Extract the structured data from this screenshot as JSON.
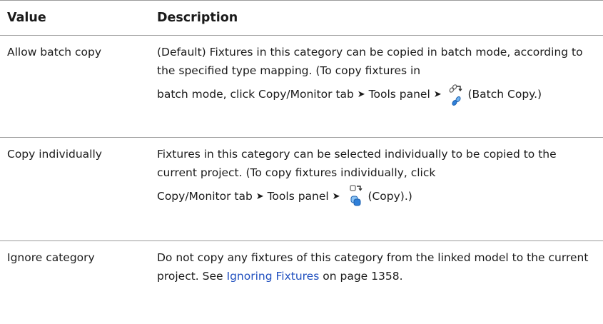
{
  "table": {
    "headers": {
      "value": "Value",
      "description": "Description"
    },
    "rows": [
      {
        "value": "Allow batch copy",
        "desc_p1": "(Default) Fixtures in this category can be copied in batch mode, according to the specified type mapping. (To copy fixtures in",
        "desc_p2": "batch mode, click Copy/Monitor tab",
        "desc_p3": "Tools panel",
        "desc_p4": "(Batch Copy.)",
        "icon": "batch-copy-icon"
      },
      {
        "value": "Copy individually",
        "desc_p1": "Fixtures in this category can be selected individually to be copied to the current project. (To copy fixtures individually, click",
        "desc_p2": "Copy/Monitor tab",
        "desc_p3": "Tools panel",
        "desc_p4": "(Copy).)",
        "icon": "copy-icon"
      },
      {
        "value": "Ignore category",
        "desc_p1": "Do not copy any fixtures of this category from the linked model to the current project. See",
        "link_text": "Ignoring Fixtures",
        "desc_p2": "on page 1358."
      }
    ],
    "arrow_glyph": "➤"
  },
  "colors": {
    "link": "#1f4fbf",
    "rule": "#9b9b9b",
    "icon_blue": "#2f7fd8"
  }
}
